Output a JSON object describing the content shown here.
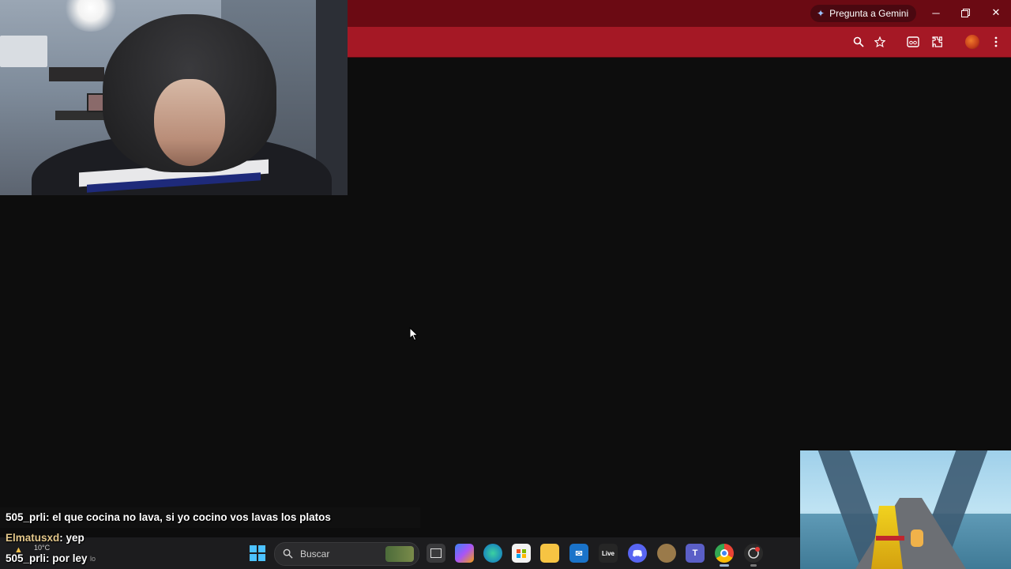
{
  "browser": {
    "gemini_label": "Pregunta a Gemini",
    "window_controls": [
      "minimize-icon",
      "restore-icon",
      "close-icon"
    ],
    "toolbar_icons": [
      "zoom-icon",
      "star-icon",
      "reading-mode-icon",
      "extensions-icon",
      "profile-avatar",
      "menu-icon"
    ],
    "theme_color": "#a51825"
  },
  "chat": {
    "messages": [
      {
        "user": "505_prli",
        "text": ": el que cocina no lava, si yo cocino vos lavas los platos"
      },
      {
        "user": "Elmatusxd",
        "text": ": yep"
      },
      {
        "user": "505_prli",
        "text": ": por ley"
      }
    ]
  },
  "taskbar": {
    "weather_temp": "10°C",
    "weather_desc": "lo",
    "search_placeholder": "Buscar",
    "live_label": "Live",
    "apps": [
      "task-view",
      "copilot",
      "edge",
      "store",
      "file-explorer",
      "outlook",
      "live",
      "discord",
      "app-8",
      "teams",
      "chrome",
      "app-11"
    ]
  }
}
